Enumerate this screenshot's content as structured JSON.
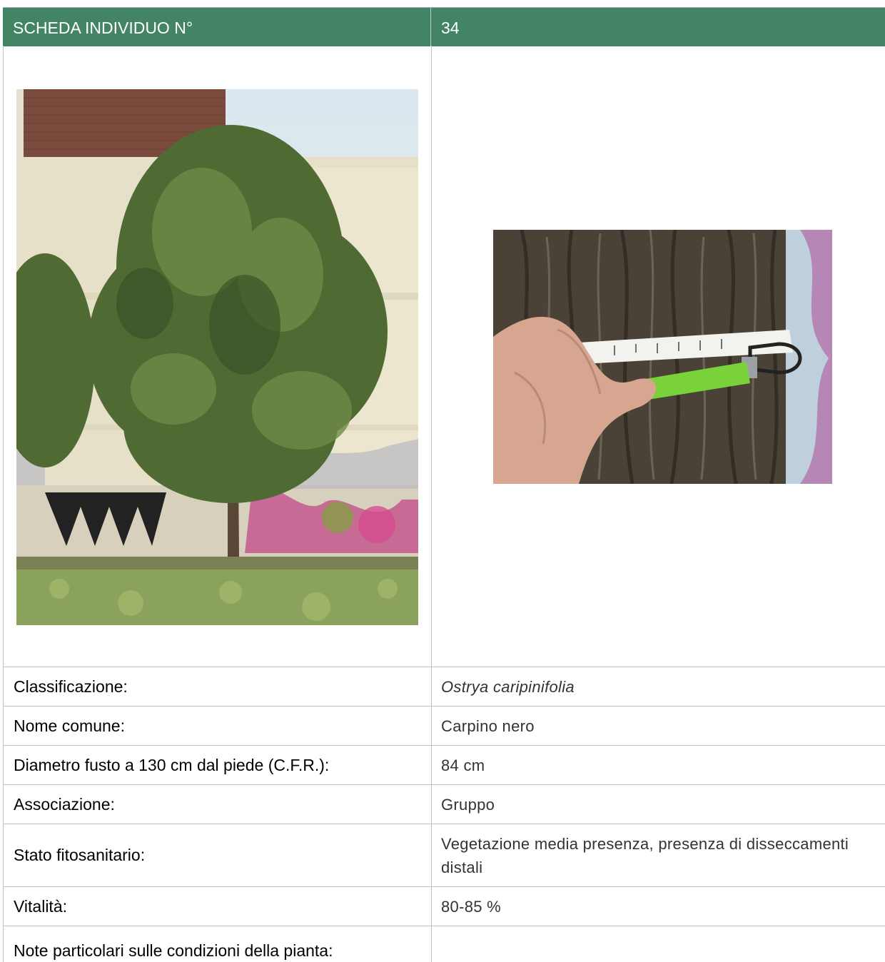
{
  "header": {
    "title_label": "SCHEDA INDIVIDUO N°",
    "number": "34"
  },
  "photos": {
    "tree": {
      "icon": "tree-photo"
    },
    "trunk": {
      "icon": "trunk-measure-photo"
    }
  },
  "fields": {
    "classificazione": {
      "label": "Classificazione:",
      "value": "Ostrya caripinifolia"
    },
    "nome_comune": {
      "label": "Nome comune:",
      "value": "Carpino nero"
    },
    "diametro": {
      "label": "Diametro fusto a 130 cm dal piede (C.F.R.):",
      "value": "84 cm"
    },
    "associazione": {
      "label": "Associazione:",
      "value": "Gruppo"
    },
    "stato": {
      "label": "Stato fitosanitario:",
      "value": "Vegetazione media presenza, presenza di disseccamenti distali"
    },
    "vitalita": {
      "label": "Vitalità:",
      "value": "80-85 %"
    },
    "note": {
      "label": "Note particolari sulle condizioni della pianta:",
      "value": ""
    }
  },
  "colors": {
    "header_bg": "#438464",
    "header_text": "#ffffff",
    "grid": "#bfbfbf"
  }
}
